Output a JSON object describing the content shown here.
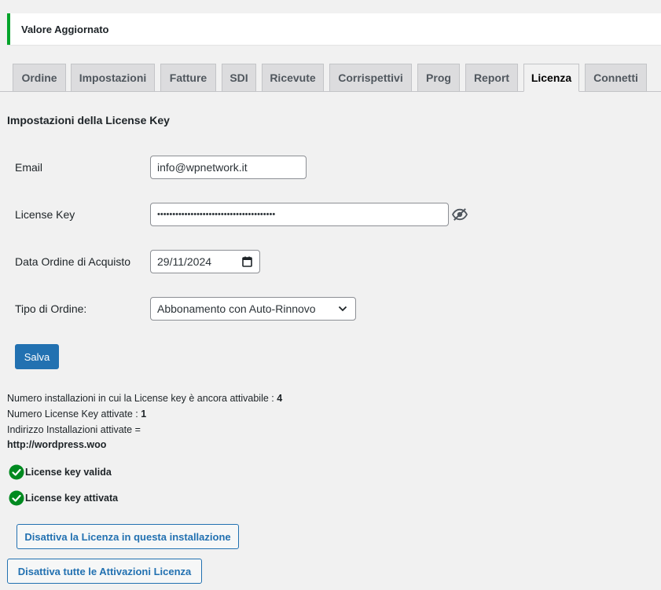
{
  "notice": {
    "text": "Valore Aggiornato",
    "accent_color": "#00a32a"
  },
  "tabs": [
    {
      "label": "Ordine",
      "active": false
    },
    {
      "label": "Impostazioni",
      "active": false
    },
    {
      "label": "Fatture",
      "active": false
    },
    {
      "label": "SDI",
      "active": false
    },
    {
      "label": "Ricevute",
      "active": false
    },
    {
      "label": "Corrispettivi",
      "active": false
    },
    {
      "label": "Prog",
      "active": false
    },
    {
      "label": "Report",
      "active": false
    },
    {
      "label": "Licenza",
      "active": true
    },
    {
      "label": "Connetti",
      "active": false
    }
  ],
  "section_title": "Impostazioni della License Key",
  "form": {
    "email_label": "Email",
    "email_value": "info@wpnetwork.it",
    "license_key_label": "License Key",
    "license_key_value": "•••••••••••••••••••••••••••••••••••••••",
    "license_key_toggle_icon": "eye-slash-icon",
    "order_date_label": "Data Ordine di Acquisto",
    "order_date_value": "29/11/2024",
    "order_type_label": "Tipo di Ordine:",
    "order_type_value": "Abbonamento con Auto-Rinnovo",
    "save_label": "Salva"
  },
  "info": {
    "remaining_label": "Numero installazioni in cui la License key è ancora attivabile :",
    "remaining_value": "4",
    "activated_label": "Numero License Key attivate :",
    "activated_value": "1",
    "address_label": "Indirizzo Installazioni attivate =",
    "address_value": "http://wordpress.woo"
  },
  "status": [
    {
      "icon": "check-circle-icon",
      "text": "License key valida"
    },
    {
      "icon": "check-circle-icon",
      "text": "License key attivata"
    }
  ],
  "actions": {
    "deactivate_this": "Disattiva la Licenza in questa installazione",
    "deactivate_all": "Disattiva tutte le Attivazioni Licenza"
  },
  "colors": {
    "primary": "#2271b1",
    "success": "#00a32a",
    "check_green": "#008a20"
  }
}
